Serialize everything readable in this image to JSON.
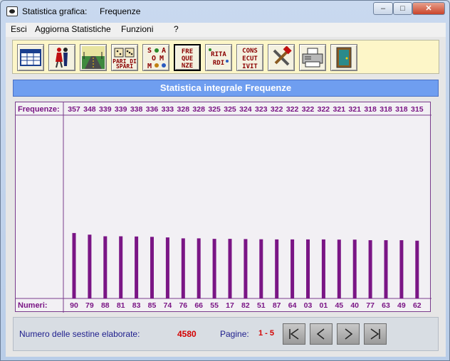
{
  "window": {
    "title_app": "Statistica grafica:",
    "title_section": "Frequenze",
    "minimize": "–",
    "maximize": "□",
    "close": "✕"
  },
  "menu": [
    "Esci",
    "Aggiorna Statistiche",
    "Funzioni",
    "?"
  ],
  "toolbar": {
    "buttons": [
      {
        "name": "table-icon",
        "text": ""
      },
      {
        "name": "dancers-icon",
        "text": ""
      },
      {
        "name": "road-icon",
        "text": ""
      },
      {
        "name": "pari-dispari-icon",
        "text": "PARI DI\nSPARI"
      },
      {
        "name": "somme-icon",
        "text": "S A\nO M\nM E"
      },
      {
        "name": "frequenze-icon",
        "text": "FRE\nQUE\nNZE"
      },
      {
        "name": "ritardi-icon",
        "text": "RITA\nRDI"
      },
      {
        "name": "consecutivi-icon",
        "text": "CONS\nECUT\nIVIT"
      },
      {
        "name": "tools-icon",
        "text": ""
      },
      {
        "name": "printer-icon",
        "text": ""
      },
      {
        "name": "exit-door-icon",
        "text": ""
      }
    ]
  },
  "banner": "Statistica integrale Frequenze",
  "chart_data": {
    "type": "bar",
    "title": "Statistica integrale Frequenze",
    "row_label_top": "Frequenze:",
    "row_label_bottom": "Numeri:",
    "categories": [
      "90",
      "79",
      "88",
      "81",
      "83",
      "85",
      "74",
      "76",
      "66",
      "55",
      "17",
      "82",
      "51",
      "87",
      "64",
      "03",
      "01",
      "45",
      "40",
      "77",
      "63",
      "49",
      "62"
    ],
    "values": [
      357,
      348,
      339,
      339,
      338,
      336,
      333,
      328,
      328,
      325,
      325,
      324,
      323,
      322,
      322,
      322,
      322,
      321,
      321,
      318,
      318,
      318,
      315
    ],
    "bar_color": "#7a1585",
    "label_color": "#7a1585",
    "ylim": [
      0,
      1000
    ],
    "grid": false
  },
  "status": {
    "label": "Numero delle sestine elaborate:",
    "value": "4580",
    "pages_label": "Pagine:",
    "pages_value": "1 - 5"
  },
  "nav": [
    {
      "name": "first-page-button"
    },
    {
      "name": "previous-page-button"
    },
    {
      "name": "next-page-button"
    },
    {
      "name": "last-page-button"
    }
  ]
}
